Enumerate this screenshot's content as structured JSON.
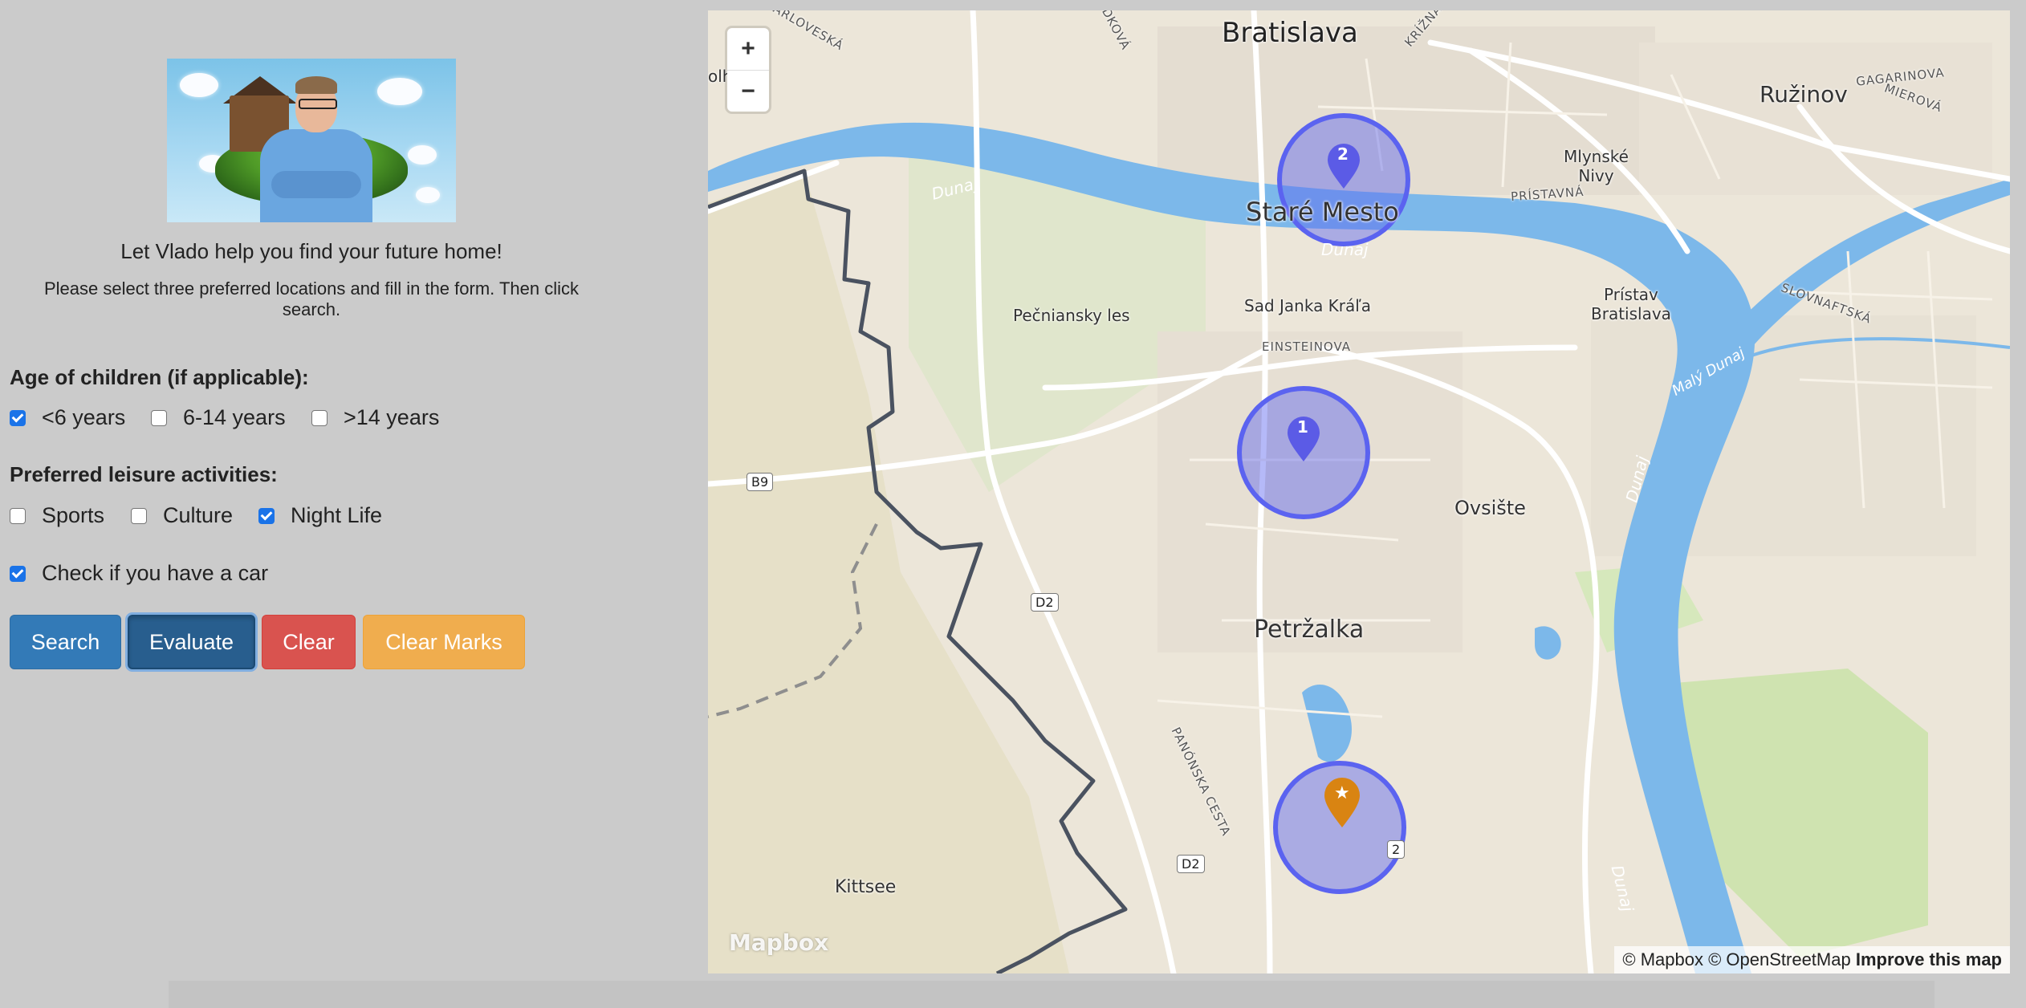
{
  "header": {
    "title": "Let Vlado help you find your future home!",
    "instructions": "Please select three preferred locations and fill in the form. Then click search."
  },
  "form": {
    "children_label": "Age of children (if applicable):",
    "children_options": [
      {
        "label": "<6 years",
        "checked": true
      },
      {
        "label": "6-14 years",
        "checked": false
      },
      {
        "label": ">14 years",
        "checked": false
      }
    ],
    "leisure_label": "Preferred leisure activities:",
    "leisure_options": [
      {
        "label": "Sports",
        "checked": false
      },
      {
        "label": "Culture",
        "checked": false
      },
      {
        "label": "Night Life",
        "checked": true
      }
    ],
    "car_label": "Check if you have a car",
    "car_checked": true
  },
  "buttons": {
    "search": "Search",
    "evaluate": "Evaluate",
    "clear": "Clear",
    "clear_marks": "Clear Marks"
  },
  "map": {
    "zoom_in": "+",
    "zoom_out": "−",
    "labels": {
      "bratislava": "Bratislava",
      "ruzinov": "Ružinov",
      "stare_mesto": "Staré Mesto",
      "petrzalka": "Petržalka",
      "ovsiste": "Ovsište",
      "kittsee": "Kittsee",
      "pecniansky": "Pečniansky les",
      "sad_janka": "Sad Janka Kráľa",
      "mlynske": "Mlynské\nNivy",
      "pristav": "Prístav\nBratislava",
      "dunaj_1": "Dunaj",
      "dunaj_2": "Dunaj",
      "dunaj_3": "Dunaj",
      "dunaj_4": "Dunaj",
      "maly_dunaj": "Malý Dunaj",
      "einsteinova": "EINSTEINOVA",
      "pristavna": "PRÍSTAVNÁ",
      "slovnaftska": "SLOVNAFTSKÁ",
      "gagarinova": "GAGARINOVA",
      "mierova": "MIEROVÁ",
      "krizna": "KRÍŽNA",
      "dkova": "DKOVÁ",
      "karlovska": "ARLOVESKÁ",
      "panonska": "PANÓNSKA CESTA",
      "olhely": "olh  ely"
    },
    "road_badges": {
      "b9": "B9",
      "d2a": "D2",
      "d2b": "D2",
      "r2": "2"
    },
    "markers": [
      {
        "label": "2",
        "color": "#5b5be6"
      },
      {
        "label": "1",
        "color": "#5b5be6"
      },
      {
        "label": "★",
        "color": "#d98412"
      }
    ],
    "logo": "Mapbox",
    "attribution_plain": "© Mapbox © OpenStreetMap",
    "attribution_link": "Improve this map"
  }
}
